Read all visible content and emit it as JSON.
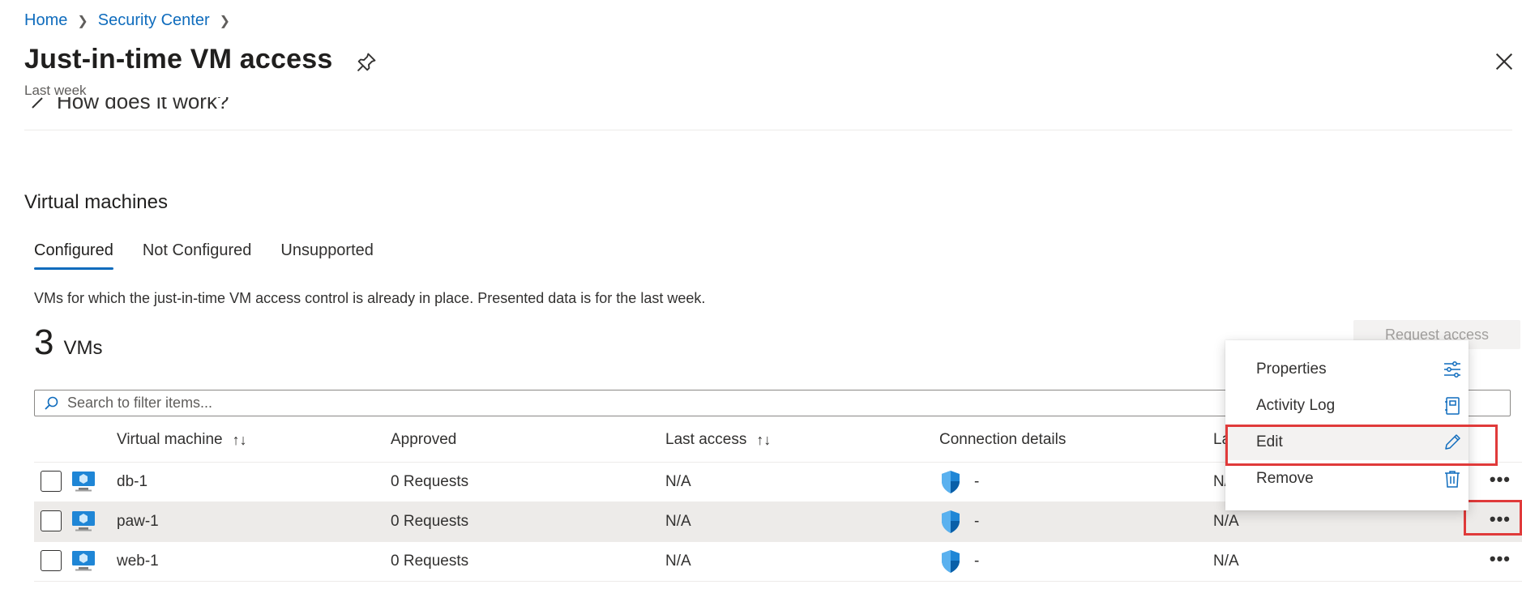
{
  "breadcrumb": {
    "home": "Home",
    "security_center": "Security Center"
  },
  "header": {
    "title": "Just-in-time VM access",
    "subtitle": "Last week"
  },
  "howto": {
    "label": "How does it work?"
  },
  "section": {
    "title": "Virtual machines"
  },
  "tabs": [
    {
      "label": "Configured",
      "active": true
    },
    {
      "label": "Not Configured",
      "active": false
    },
    {
      "label": "Unsupported",
      "active": false
    }
  ],
  "description": "VMs for which the just-in-time VM access control is already in place. Presented data is for the last week.",
  "count": {
    "value": "3",
    "unit": "VMs"
  },
  "actions": {
    "request_access": "Request access"
  },
  "search": {
    "placeholder": "Search to filter items..."
  },
  "table": {
    "columns": [
      "Virtual machine",
      "Approved",
      "Last access",
      "Connection details",
      "La"
    ],
    "rows": [
      {
        "name": "db-1",
        "approved": "0 Requests",
        "last_access": "N/A",
        "connection": "-",
        "last_user": "N/A"
      },
      {
        "name": "paw-1",
        "approved": "0 Requests",
        "last_access": "N/A",
        "connection": "-",
        "last_user": "N/A"
      },
      {
        "name": "web-1",
        "approved": "0 Requests",
        "last_access": "N/A",
        "connection": "-",
        "last_user": "N/A"
      }
    ]
  },
  "context_menu": {
    "items": [
      {
        "label": "Properties",
        "icon": "sliders-icon"
      },
      {
        "label": "Activity Log",
        "icon": "log-book-icon"
      },
      {
        "label": "Edit",
        "icon": "pencil-icon"
      },
      {
        "label": "Remove",
        "icon": "trash-icon"
      }
    ]
  },
  "colors": {
    "accent": "#0f6cbd",
    "highlight": "#e03a3a"
  }
}
